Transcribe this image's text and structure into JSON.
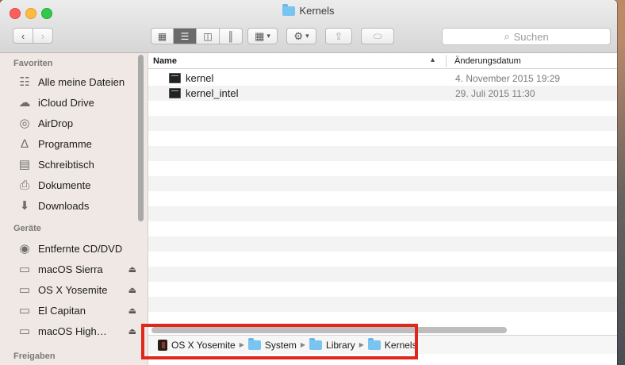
{
  "window": {
    "title": "Kernels"
  },
  "toolbar": {
    "back_icon": "chevron-left",
    "forward_icon": "chevron-right",
    "search_placeholder": "Suchen"
  },
  "sidebar": {
    "favorites_header": "Favoriten",
    "favorites": [
      {
        "label": "Alle meine Dateien",
        "icon": "all-files-icon"
      },
      {
        "label": "iCloud Drive",
        "icon": "cloud-icon"
      },
      {
        "label": "AirDrop",
        "icon": "airdrop-icon"
      },
      {
        "label": "Programme",
        "icon": "applications-icon"
      },
      {
        "label": "Schreibtisch",
        "icon": "desktop-icon"
      },
      {
        "label": "Dokumente",
        "icon": "documents-icon"
      },
      {
        "label": "Downloads",
        "icon": "downloads-icon"
      }
    ],
    "devices_header": "Geräte",
    "devices": [
      {
        "label": "Entfernte CD/DVD",
        "icon": "optical-disc-icon"
      },
      {
        "label": "macOS Sierra",
        "icon": "hard-disk-icon"
      },
      {
        "label": "OS X Yosemite",
        "icon": "hard-disk-icon"
      },
      {
        "label": "El Capitan",
        "icon": "hard-disk-icon"
      },
      {
        "label": "macOS High…",
        "icon": "hard-disk-icon"
      }
    ],
    "shared_header": "Freigaben"
  },
  "columns": {
    "name": "Name",
    "date": "Änderungsdatum"
  },
  "files": [
    {
      "name": "kernel",
      "date": "4. November 2015 19:29"
    },
    {
      "name": "kernel_intel",
      "date": "29. Juli 2015 11:30"
    }
  ],
  "path": [
    "OS X Yosemite",
    "System",
    "Library",
    "Kernels"
  ],
  "colors": {
    "highlight": "#e0271c",
    "folder": "#7ac4f2"
  }
}
